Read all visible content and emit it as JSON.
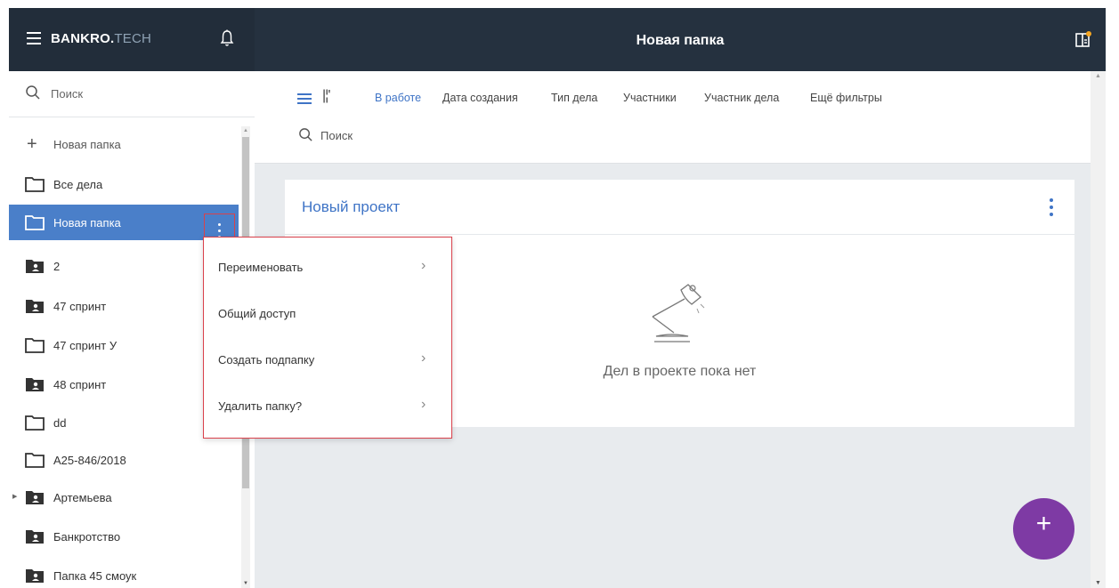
{
  "header": {
    "brand_main": "BANKRO.",
    "brand_suffix": "TECH",
    "title": "Новая папка",
    "accent_dot_color": "#f5a623"
  },
  "sidebar": {
    "search_placeholder": "Поиск",
    "new_folder_label": "Новая папка",
    "items": [
      {
        "label": "Все дела",
        "icon": "folder-outline-icon"
      },
      {
        "label": "Новая папка",
        "icon": "folder-outline-icon",
        "active": true
      },
      {
        "label": "2",
        "icon": "shared-folder-icon"
      },
      {
        "label": "47 спринт",
        "icon": "shared-folder-icon"
      },
      {
        "label": "47 спринт У",
        "icon": "folder-outline-icon"
      },
      {
        "label": "48 спринт",
        "icon": "shared-folder-icon"
      },
      {
        "label": "dd",
        "icon": "folder-outline-icon"
      },
      {
        "label": "А25-846/2018",
        "icon": "folder-outline-icon"
      },
      {
        "label": "Артемьева",
        "icon": "shared-folder-icon",
        "expandable": true
      },
      {
        "label": "Банкротство",
        "icon": "shared-folder-icon"
      },
      {
        "label": "Папка 45 смоук",
        "icon": "shared-folder-icon"
      }
    ]
  },
  "filters": {
    "tabs": [
      "В работе",
      "Дата создания",
      "Тип дела",
      "Участники",
      "Участник дела",
      "Ещё фильтры"
    ],
    "active_tab": "В работе",
    "search_placeholder": "Поиск"
  },
  "project": {
    "title": "Новый проект",
    "empty_text": "Дел в проекте пока нет"
  },
  "context_menu": {
    "items": [
      {
        "label": "Переименовать",
        "has_arrow": true
      },
      {
        "label": "Общий доступ",
        "has_arrow": false
      },
      {
        "label": "Создать подпапку",
        "has_arrow": true
      },
      {
        "label": "Удалить папку?",
        "has_arrow": true
      }
    ]
  },
  "colors": {
    "header_bg": "#25313f",
    "accent_blue": "#3f74c6",
    "active_item_bg": "#4a7fc9",
    "fab_purple": "#7e3aa4",
    "highlight_red": "#d9414b"
  },
  "fab": {
    "label": "+"
  }
}
